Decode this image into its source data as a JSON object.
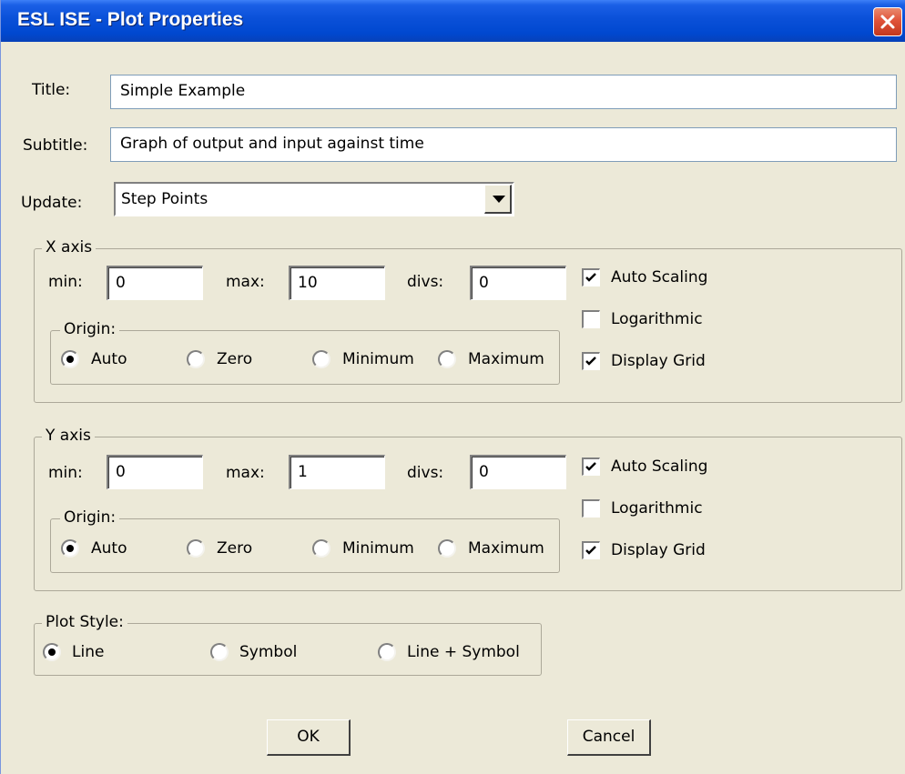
{
  "window": {
    "title": "ESL ISE - Plot Properties"
  },
  "title": {
    "label": "Title:",
    "value": "Simple Example"
  },
  "subtitle": {
    "label": "Subtitle:",
    "value": "Graph of output and input against time"
  },
  "update": {
    "label": "Update:",
    "value": "Step Points"
  },
  "x_axis": {
    "legend": "X axis",
    "min_label": "min:",
    "min_value": "0",
    "max_label": "max:",
    "max_value": "10",
    "divs_label": "divs:",
    "divs_value": "0",
    "auto_scaling": {
      "label": "Auto Scaling",
      "checked": true
    },
    "logarithmic": {
      "label": "Logarithmic",
      "checked": false
    },
    "display_grid": {
      "label": "Display Grid",
      "checked": true
    },
    "origin": {
      "legend": "Origin:",
      "options": [
        "Auto",
        "Zero",
        "Minimum",
        "Maximum"
      ],
      "selected": "Auto"
    }
  },
  "y_axis": {
    "legend": "Y axis",
    "min_label": "min:",
    "min_value": "0",
    "max_label": "max:",
    "max_value": "1",
    "divs_label": "divs:",
    "divs_value": "0",
    "auto_scaling": {
      "label": "Auto Scaling",
      "checked": true
    },
    "logarithmic": {
      "label": "Logarithmic",
      "checked": false
    },
    "display_grid": {
      "label": "Display Grid",
      "checked": true
    },
    "origin": {
      "legend": "Origin:",
      "options": [
        "Auto",
        "Zero",
        "Minimum",
        "Maximum"
      ],
      "selected": "Auto"
    }
  },
  "plot_style": {
    "legend": "Plot Style:",
    "options": [
      "Line",
      "Symbol",
      "Line + Symbol"
    ],
    "selected": "Line"
  },
  "buttons": {
    "ok": "OK",
    "cancel": "Cancel"
  },
  "icons": {
    "close": "close-icon",
    "dropdown": "chevron-down-icon",
    "check": "checkmark-icon"
  }
}
